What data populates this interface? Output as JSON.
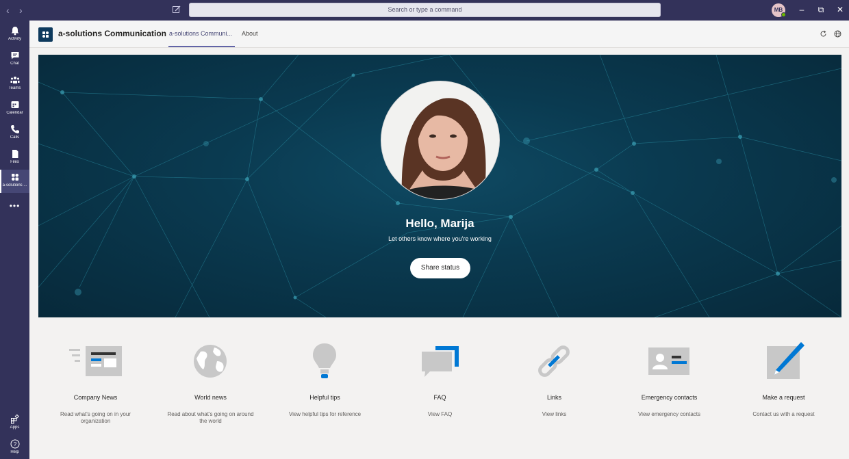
{
  "titlebar": {
    "search_placeholder": "Search or type a command",
    "avatar_initials": "MB"
  },
  "rail": {
    "items": [
      {
        "label": "Activity",
        "icon": "bell-icon"
      },
      {
        "label": "Chat",
        "icon": "chat-icon"
      },
      {
        "label": "Teams",
        "icon": "teams-icon"
      },
      {
        "label": "Calendar",
        "icon": "calendar-icon"
      },
      {
        "label": "Calls",
        "icon": "phone-icon"
      },
      {
        "label": "Files",
        "icon": "file-icon"
      },
      {
        "label": "a-solutions ...",
        "icon": "app-icon"
      }
    ],
    "more": "•••",
    "apps_label": "Apps",
    "help_label": "Help"
  },
  "header": {
    "app_title": "a-solutions Communication",
    "tabs": [
      {
        "label": "a-solutions Communi..."
      },
      {
        "label": "About"
      }
    ]
  },
  "hero": {
    "greeting": "Hello, Marija",
    "subtitle": "Let others know where you're working",
    "share_button": "Share status"
  },
  "tiles": [
    {
      "title": "Company News",
      "description": "Read what's going on in your organization",
      "icon": "newspaper-icon"
    },
    {
      "title": "World news",
      "description": "Read about what's going on around the world",
      "icon": "globe-icon"
    },
    {
      "title": "Helpful tips",
      "description": "View helpful tips for reference",
      "icon": "lightbulb-icon"
    },
    {
      "title": "FAQ",
      "description": "View FAQ",
      "icon": "speech-bubble-icon"
    },
    {
      "title": "Links",
      "description": "View links",
      "icon": "link-icon"
    },
    {
      "title": "Emergency contacts",
      "description": "View emergency contacts",
      "icon": "contact-card-icon"
    },
    {
      "title": "Make a request",
      "description": "Contact us with a request",
      "icon": "pen-icon"
    }
  ],
  "colors": {
    "rail": "#33325a",
    "accent": "#6264a7",
    "hero": "#0a3a50",
    "icon_blue": "#0078d4",
    "icon_gray": "#c8c8c8"
  }
}
